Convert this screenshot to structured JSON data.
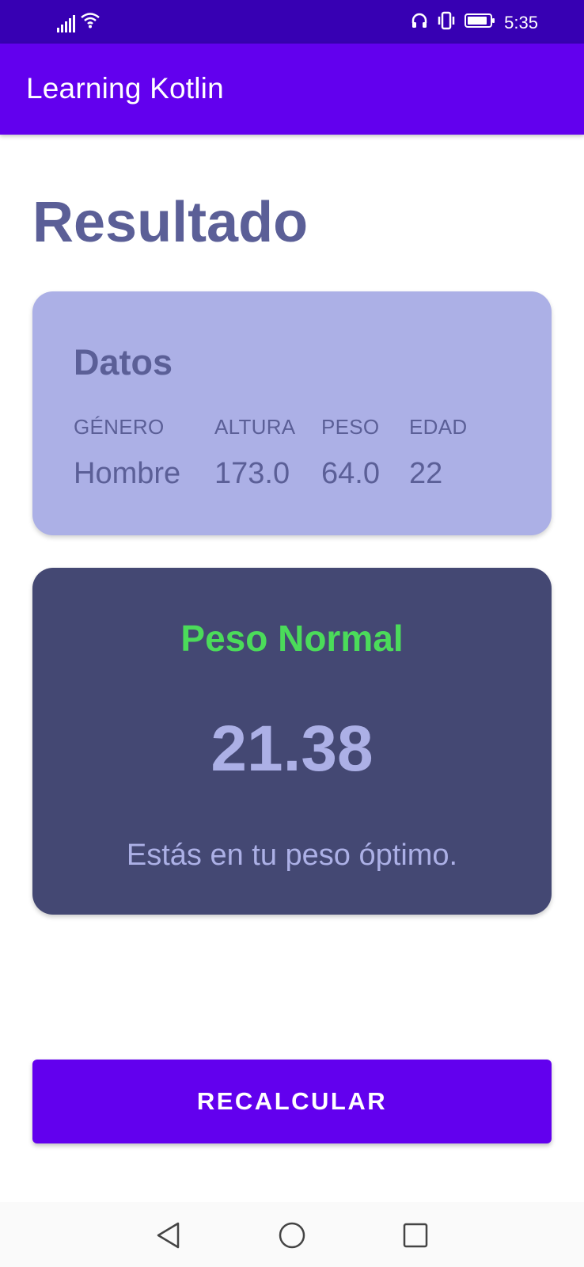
{
  "status_bar": {
    "time": "5:35",
    "icons": [
      "signal-icon",
      "wifi-icon",
      "headphones-icon",
      "vibrate-icon",
      "battery-icon"
    ]
  },
  "app_bar": {
    "title": "Learning Kotlin"
  },
  "page": {
    "title": "Resultado"
  },
  "datos_card": {
    "title": "Datos",
    "columns": [
      {
        "label": "GÉNERO",
        "value": "Hombre"
      },
      {
        "label": "ALTURA",
        "value": "173.0"
      },
      {
        "label": "PESO",
        "value": "64.0"
      },
      {
        "label": "EDAD",
        "value": "22"
      }
    ]
  },
  "result_card": {
    "status": "Peso Normal",
    "value": "21.38",
    "description": "Estás en tu peso óptimo."
  },
  "button": {
    "label": "RECALCULAR"
  },
  "nav_bar": {
    "icons": [
      "back-icon",
      "home-icon",
      "recents-icon"
    ]
  },
  "colors": {
    "status_bar": "#3700B3",
    "primary": "#6200EE",
    "title_text": "#5B5F97",
    "datos_card_bg": "#ACB0E6",
    "result_card_bg": "#444873",
    "status_green": "#4BDB5A"
  }
}
